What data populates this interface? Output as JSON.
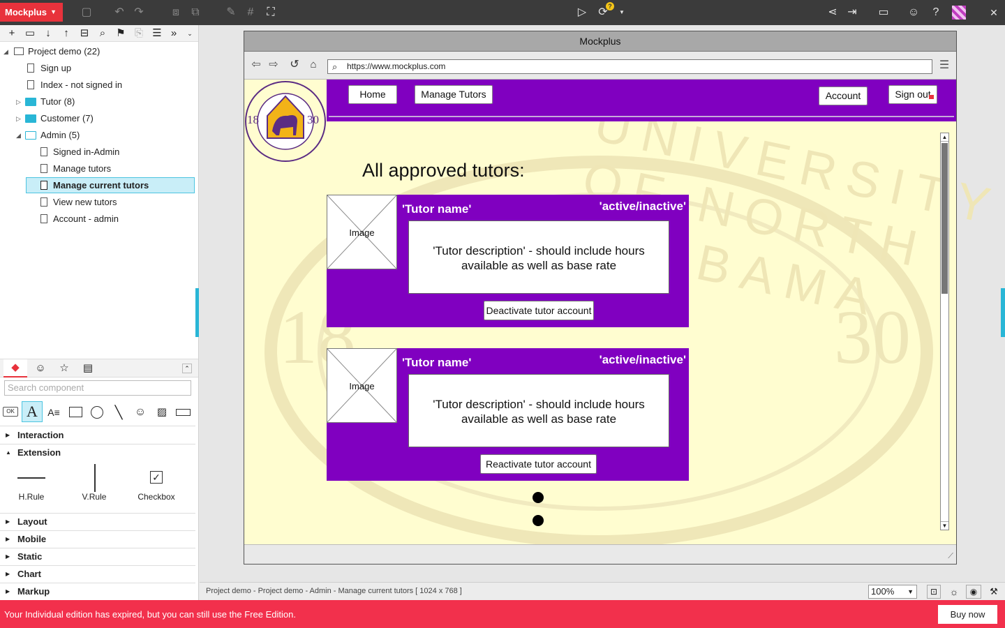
{
  "app": {
    "brand": "Mockplus"
  },
  "project_tree": {
    "root_label": "Project demo (22)",
    "items": [
      {
        "label": "Sign up",
        "type": "page"
      },
      {
        "label": "Index - not signed in",
        "type": "page"
      },
      {
        "label": "Tutor (8)",
        "type": "folder"
      },
      {
        "label": "Customer (7)",
        "type": "folder"
      },
      {
        "label": "Admin (5)",
        "type": "folder-open"
      },
      {
        "label": "Signed in-Admin",
        "type": "page"
      },
      {
        "label": "Manage tutors",
        "type": "page"
      },
      {
        "label": "Manage current tutors",
        "type": "page",
        "selected": true
      },
      {
        "label": "View new tutors",
        "type": "page"
      },
      {
        "label": "Account - admin",
        "type": "page"
      }
    ]
  },
  "components": {
    "search_placeholder": "Search component",
    "categories": [
      "Interaction",
      "Extension",
      "Layout",
      "Mobile",
      "Static",
      "Chart",
      "Markup"
    ],
    "extension_items": [
      "H.Rule",
      "V.Rule",
      "Checkbox"
    ]
  },
  "browser": {
    "title": "Mockplus",
    "url": "https://www.mockplus.com"
  },
  "site": {
    "logo_text": "UNIVERSITY OF NORTH ALABAMA",
    "logo_year_left": "18",
    "logo_year_right": "30",
    "nav_buttons": [
      "Home",
      "Manage Tutors",
      "Account",
      "Sign out"
    ],
    "heading": "All approved tutors:",
    "cards": [
      {
        "image_label": "Image",
        "name": "'Tutor name'",
        "status": "'active/inactive'",
        "description": "'Tutor description' - should include hours available as well as base rate",
        "action": "Deactivate tutor account"
      },
      {
        "image_label": "Image",
        "name": "'Tutor name'",
        "status": "'active/inactive'",
        "description": "'Tutor description' - should include hours available as well as base rate",
        "action": "Reactivate tutor account"
      }
    ]
  },
  "status": {
    "path": "Project demo - Project demo - Admin - Manage current tutors [ 1024 x 768 ]",
    "zoom": "100%"
  },
  "footer": {
    "message": "Your Individual edition has expired, but you can still use the Free Edition.",
    "buy_label": "Buy now"
  },
  "colors": {
    "brand_red": "#e8323c",
    "purple": "#8000c0",
    "canvas": "#fffdd0",
    "footer_red": "#f2304c",
    "selection": "#c9eef8"
  }
}
